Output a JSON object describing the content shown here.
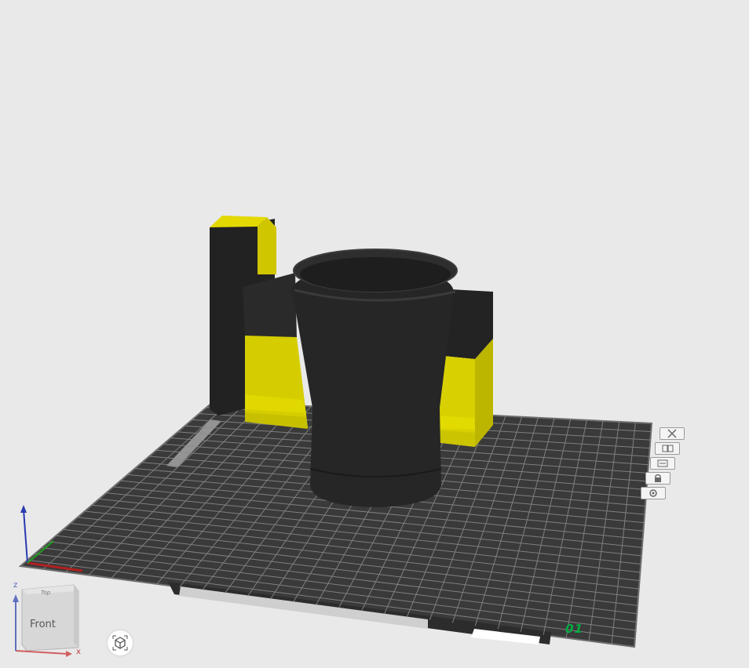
{
  "plate": {
    "number": "01",
    "tools": [
      {
        "name": "close-plate-button",
        "icon": "close-icon"
      },
      {
        "name": "arrange-plate-button",
        "icon": "arrange-icon"
      },
      {
        "name": "orient-plate-button",
        "icon": "orient-icon"
      },
      {
        "name": "lock-plate-button",
        "icon": "lock-icon"
      },
      {
        "name": "plate-settings-button",
        "icon": "settings-icon"
      }
    ]
  },
  "view_cube": {
    "face_label": "Front",
    "top_label": "Top",
    "axis_x": "x",
    "axis_z": "z"
  },
  "view_reset": {
    "icon": "cube-view-icon"
  },
  "colors": {
    "background": "#e9e9e9",
    "plate": "#3a3a3a",
    "grid": "#8c8c8c",
    "model_black": "#262626",
    "model_yellow": "#d8d000",
    "accent": "#00ae42"
  }
}
